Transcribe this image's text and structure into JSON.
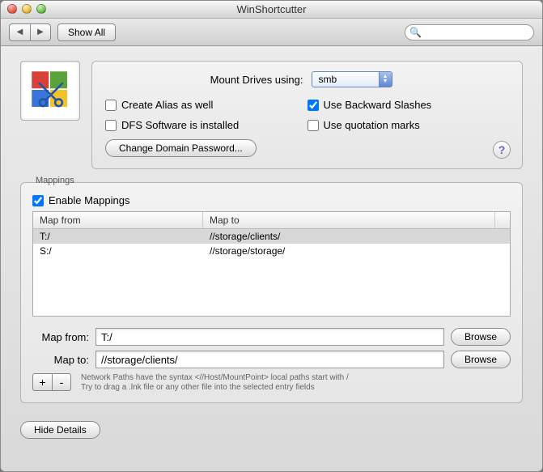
{
  "window": {
    "title": "WinShortcutter"
  },
  "toolbar": {
    "show_all": "Show All",
    "search_placeholder": ""
  },
  "upper": {
    "mount_label": "Mount Drives using:",
    "mount_value": "smb",
    "checks": {
      "alias": "Create Alias as well",
      "backslash": "Use Backward Slashes",
      "dfs": "DFS Software is installed",
      "quotes": "Use quotation marks"
    },
    "change_pw": "Change Domain Password..."
  },
  "mappings": {
    "group_title": "Mappings",
    "enable": "Enable Mappings",
    "columns": {
      "from": "Map from",
      "to": "Map to"
    },
    "rows": [
      {
        "from": "T:/",
        "to": "//storage/clients/"
      },
      {
        "from": "S:/",
        "to": "//storage/storage/"
      }
    ],
    "map_from_label": "Map from:",
    "map_to_label": "Map to:",
    "map_from_value": "T:/",
    "map_to_value": "//storage/clients/",
    "browse": "Browse",
    "hint1": "Network Paths have the syntax <//Host/MountPoint> local paths start with /",
    "hint2": "Try to drag a .lnk file or any other file into the selected entry fields",
    "plus": "+",
    "minus": "-"
  },
  "footer": {
    "hide_details": "Hide Details"
  },
  "help_glyph": "?"
}
